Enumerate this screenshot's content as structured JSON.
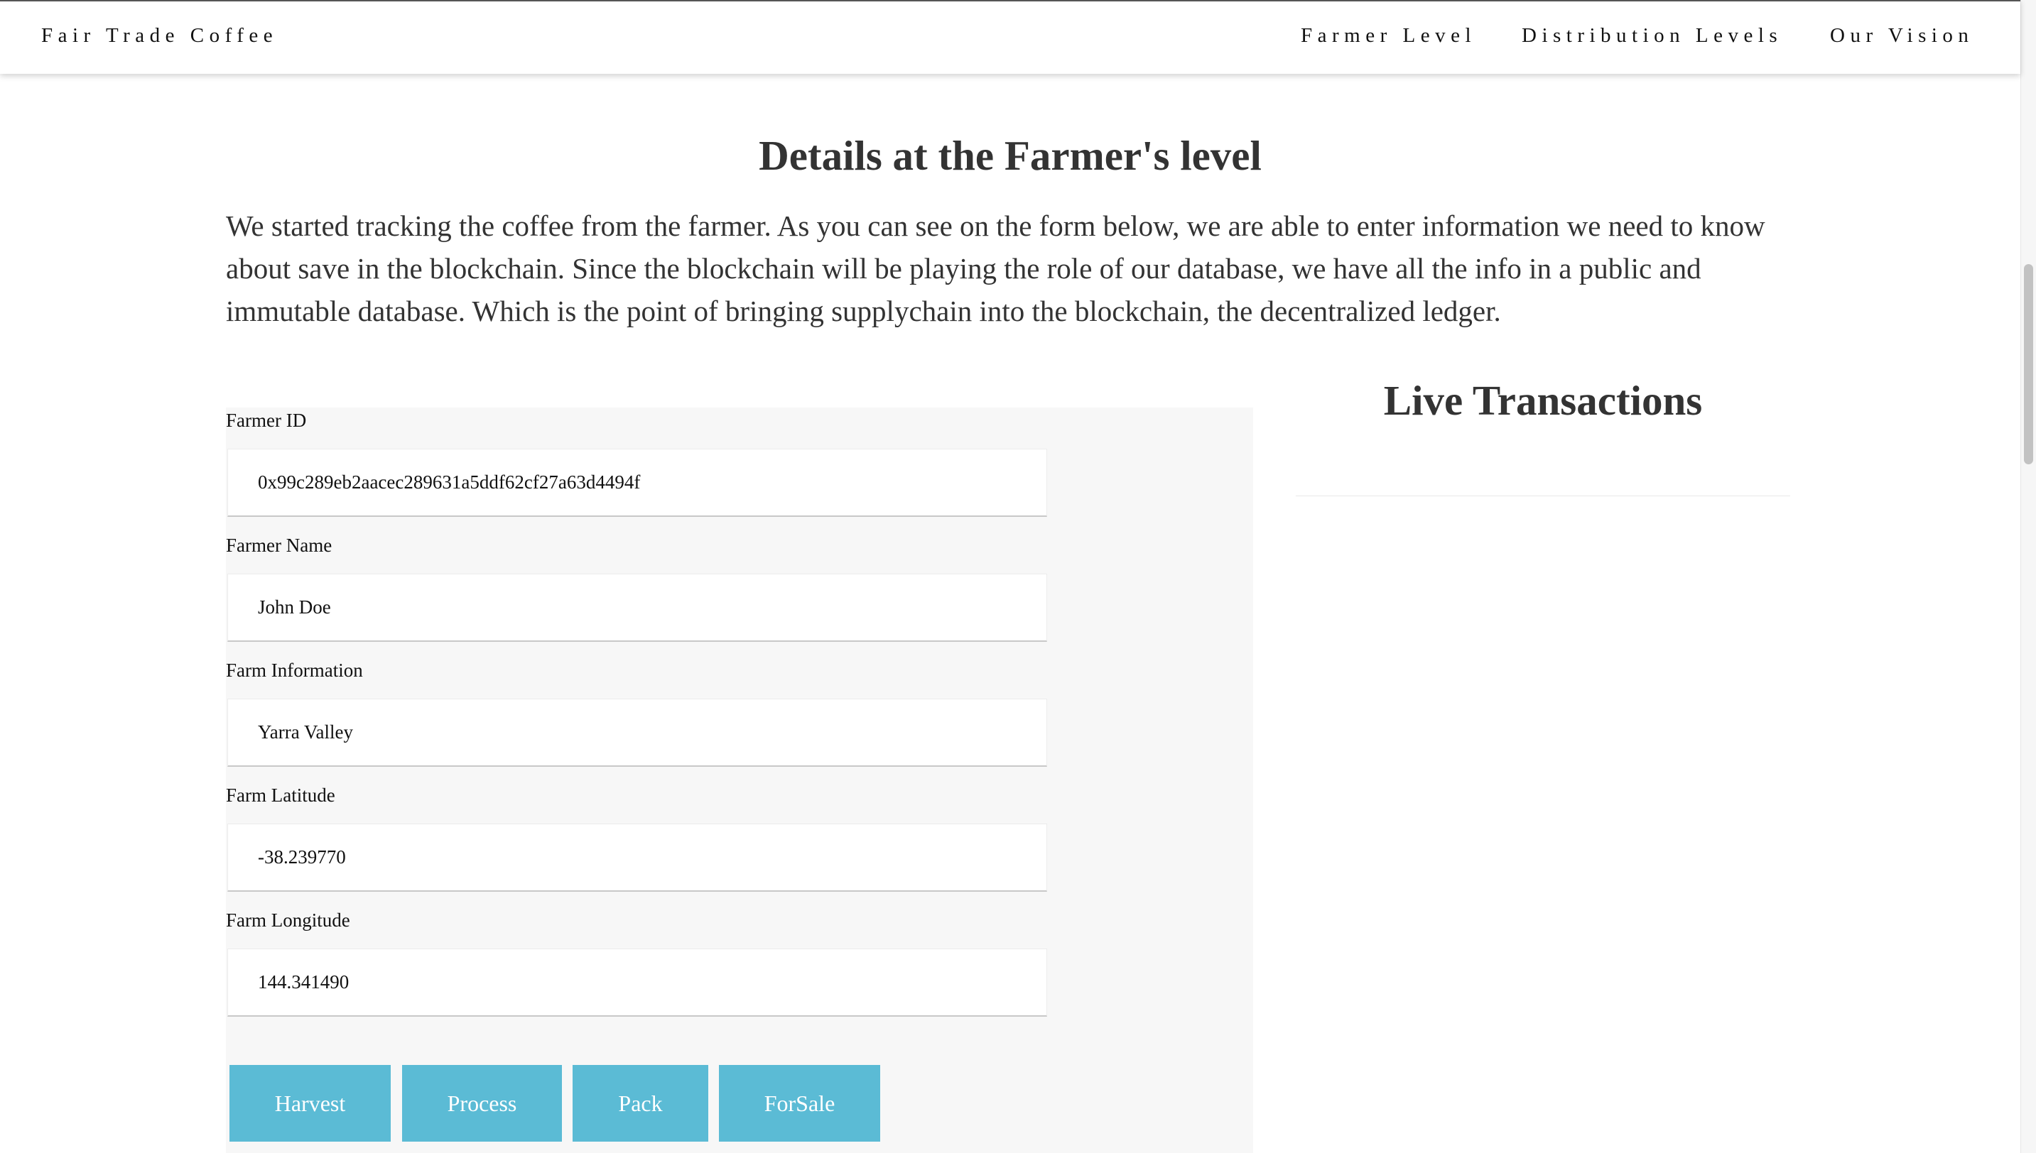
{
  "header": {
    "brand": "Fair Trade Coffee",
    "nav": [
      "Farmer Level",
      "Distribution Levels",
      "Our Vision"
    ]
  },
  "main": {
    "title": "Details at the Farmer's level",
    "intro": "We started tracking the coffee from the farmer. As you can see on the form below, we are able to enter information we need to know about save in the blockchain. Since the blockchain will be playing the role of our database, we have all the info in a public and immutable database. Which is the point of bringing supplychain into the blockchain, the decentralized ledger."
  },
  "form": {
    "fields": [
      {
        "label": "Farmer ID",
        "value": "0x99c289eb2aacec289631a5ddf62cf27a63d4494f"
      },
      {
        "label": "Farmer Name",
        "value": "John Doe"
      },
      {
        "label": "Farm Information",
        "value": "Yarra Valley"
      },
      {
        "label": "Farm Latitude",
        "value": "-38.239770"
      },
      {
        "label": "Farm Longitude",
        "value": "144.341490"
      }
    ],
    "buttons": [
      "Harvest",
      "Process",
      "Pack",
      "ForSale"
    ]
  },
  "live": {
    "title": "Live Transactions"
  },
  "colors": {
    "button_background": "#5bbbd5",
    "form_panel": "#f7f7f7",
    "heading_text": "#333333"
  }
}
